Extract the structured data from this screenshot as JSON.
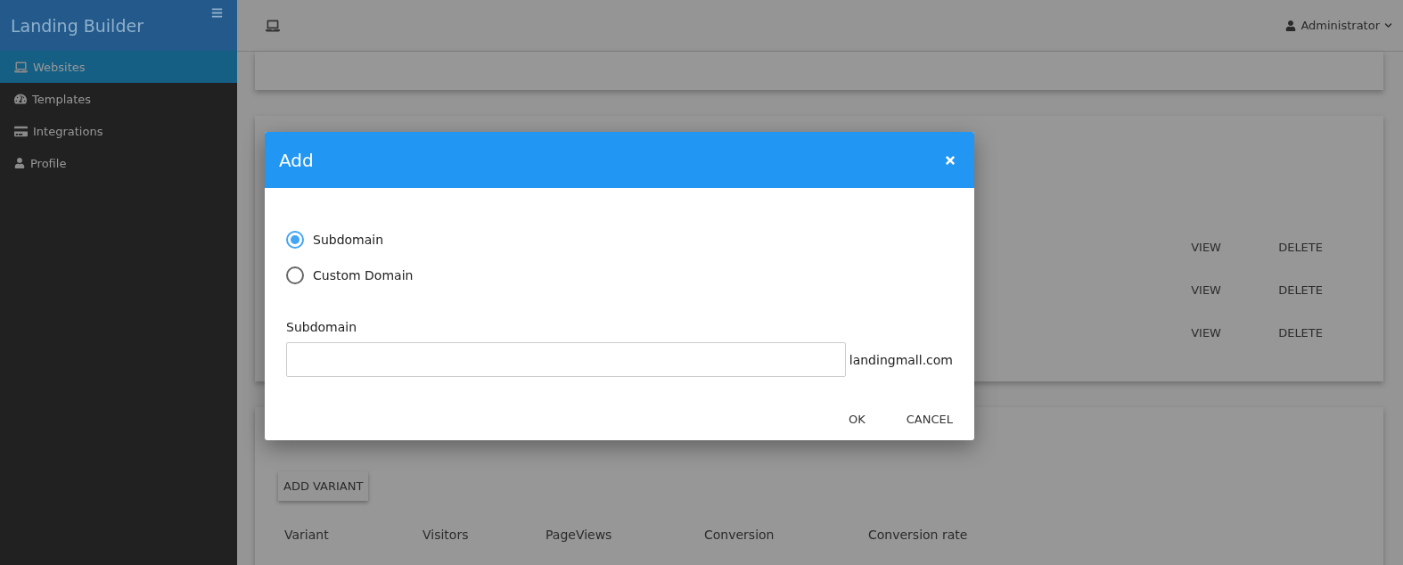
{
  "sidebar": {
    "title": "Landing Builder",
    "items": [
      {
        "label": "Websites",
        "selected": true
      },
      {
        "label": "Templates",
        "selected": false
      },
      {
        "label": "Integrations",
        "selected": false
      },
      {
        "label": "Profile",
        "selected": false
      }
    ]
  },
  "topbar": {
    "user": "Administrator"
  },
  "sites_card": {
    "rows": [
      {
        "actions": [
          "VIEW",
          "DELETE"
        ]
      },
      {
        "actions": [
          "VIEW",
          "DELETE"
        ]
      },
      {
        "actions": [
          "VIEW",
          "DELETE"
        ]
      }
    ]
  },
  "variants_card": {
    "add_button": "ADD VARIANT",
    "columns": [
      "Variant",
      "Visitors",
      "PageViews",
      "Conversion",
      "Conversion rate"
    ]
  },
  "dialog": {
    "title": "Add",
    "options": [
      {
        "label": "Subdomain",
        "selected": true
      },
      {
        "label": "Custom Domain",
        "selected": false
      }
    ],
    "field_label": "Subdomain",
    "suffix": "landingmall.com",
    "buttons": [
      "OK",
      "CANCEL"
    ]
  }
}
